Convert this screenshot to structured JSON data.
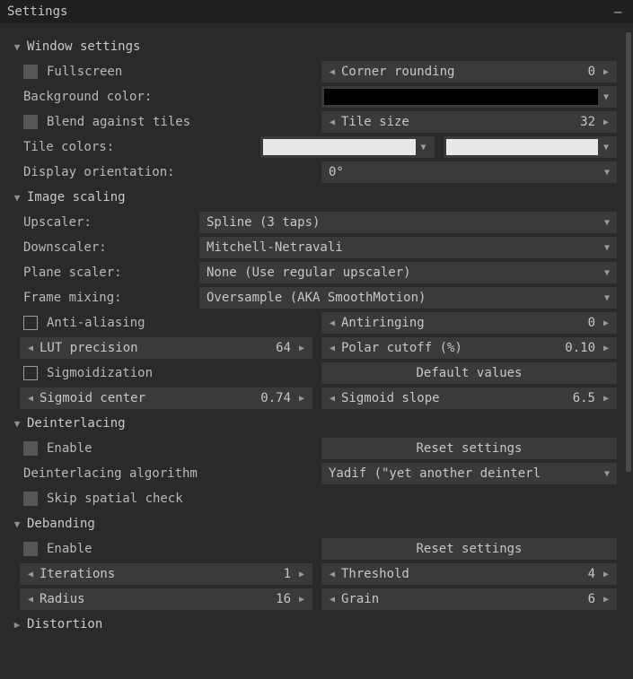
{
  "title": "Settings",
  "sections": {
    "window": {
      "header": "Window settings",
      "fullscreen": "Fullscreen",
      "corner_rounding": {
        "label": "Corner rounding",
        "value": "0"
      },
      "background_color": "Background color:",
      "blend_against_tiles": "Blend against tiles",
      "tile_size": {
        "label": "Tile size",
        "value": "32"
      },
      "tile_colors": "Tile colors:",
      "display_orientation": "Display orientation:",
      "orientation_value": "0°"
    },
    "scaling": {
      "header": "Image scaling",
      "upscaler": {
        "label": "Upscaler:",
        "value": "Spline (3 taps)"
      },
      "downscaler": {
        "label": "Downscaler:",
        "value": "Mitchell-Netravali"
      },
      "plane_scaler": {
        "label": "Plane scaler:",
        "value": "None (Use regular upscaler)"
      },
      "frame_mixing": {
        "label": "Frame mixing:",
        "value": "Oversample (AKA SmoothMotion)"
      },
      "anti_aliasing": "Anti-aliasing",
      "antiringing": {
        "label": "Antiringing",
        "value": "0"
      },
      "lut_precision": {
        "label": "LUT precision",
        "value": "64"
      },
      "polar_cutoff": {
        "label": "Polar cutoff (%)",
        "value": "0.10"
      },
      "sigmoidization": "Sigmoidization",
      "default_values": "Default values",
      "sigmoid_center": {
        "label": "Sigmoid center",
        "value": "0.74"
      },
      "sigmoid_slope": {
        "label": "Sigmoid slope",
        "value": "6.5"
      }
    },
    "deinterlacing": {
      "header": "Deinterlacing",
      "enable": "Enable",
      "reset": "Reset settings",
      "algorithm": {
        "label": "Deinterlacing algorithm",
        "value": "Yadif (\"yet another deinterl"
      },
      "skip_spatial": "Skip spatial check"
    },
    "debanding": {
      "header": "Debanding",
      "enable": "Enable",
      "reset": "Reset settings",
      "iterations": {
        "label": "Iterations",
        "value": "1"
      },
      "threshold": {
        "label": "Threshold",
        "value": "4"
      },
      "radius": {
        "label": "Radius",
        "value": "16"
      },
      "grain": {
        "label": "Grain",
        "value": "6"
      }
    },
    "distortion": {
      "header": "Distortion"
    }
  }
}
